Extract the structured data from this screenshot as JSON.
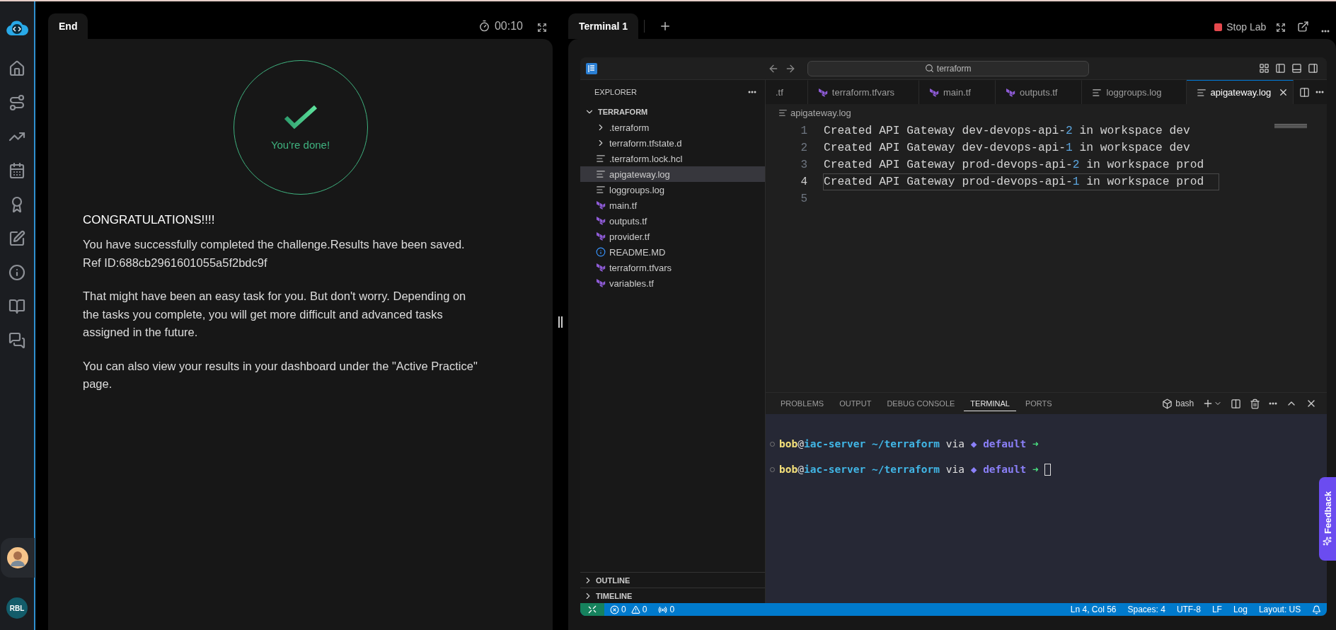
{
  "user": {
    "initials": "RBL"
  },
  "left_panel": {
    "tab": "End",
    "timer": "00:10",
    "status": "You're done!",
    "heading": "CONGRATULATIONS!!!!",
    "paragraphs": [
      "You have successfully completed the challenge.Results have been saved. Ref ID:688cb2961601055a5f2bdc9f",
      "That might have been an easy task for you. But don't worry. Depending on the tasks you complete, you will get more difficult and advanced tasks assigned in the future.",
      "You can also view your results in your dashboard under the \"Active Practice\" page."
    ]
  },
  "right_panel": {
    "tabs": [
      {
        "label": "Terminal 1",
        "selected": true
      }
    ],
    "stop_button": "Stop Lab"
  },
  "vscode": {
    "search": "terraform",
    "explorer": {
      "title": "EXPLORER",
      "tree": {
        "label": "TERRAFORM",
        "expanded": true,
        "children": [
          {
            "label": ".terraform",
            "kind": "folder",
            "expanded": false,
            "selected": false
          },
          {
            "label": "terraform.tfstate.d",
            "kind": "folder",
            "expanded": false,
            "selected": false
          },
          {
            "label": ".terraform.lock.hcl",
            "kind": "log",
            "selected": false
          },
          {
            "label": "apigateway.log",
            "kind": "log",
            "selected": true
          },
          {
            "label": "loggroups.log",
            "kind": "log",
            "selected": false
          },
          {
            "label": "main.tf",
            "kind": "terraform",
            "selected": false
          },
          {
            "label": "outputs.tf",
            "kind": "terraform",
            "selected": false
          },
          {
            "label": "provider.tf",
            "kind": "terraform",
            "selected": false
          },
          {
            "label": "README.MD",
            "kind": "info",
            "selected": false
          },
          {
            "label": "terraform.tfvars",
            "kind": "terraform",
            "selected": false
          },
          {
            "label": "variables.tf",
            "kind": "terraform",
            "selected": false
          }
        ]
      },
      "sections": [
        {
          "label": "OUTLINE",
          "expanded": false
        },
        {
          "label": "TIMELINE",
          "expanded": false
        }
      ]
    },
    "tabs": [
      {
        "label": ".tf",
        "kind": "none",
        "selected": false
      },
      {
        "label": "terraform.tfvars",
        "kind": "terraform",
        "selected": false
      },
      {
        "label": "main.tf",
        "kind": "terraform",
        "selected": false
      },
      {
        "label": "outputs.tf",
        "kind": "terraform",
        "selected": false
      },
      {
        "label": "loggroups.log",
        "kind": "log",
        "selected": false
      },
      {
        "label": "apigateway.log",
        "kind": "log",
        "selected": true
      }
    ],
    "breadcrumb": "apigateway.log",
    "code_lines": [
      {
        "number": "1",
        "current": false,
        "segments": [
          {
            "text": "Created API Gateway dev-devops-api-",
            "kind": "plain"
          },
          {
            "text": "2",
            "kind": "number"
          },
          {
            "text": " in workspace dev",
            "kind": "plain"
          }
        ]
      },
      {
        "number": "2",
        "current": false,
        "segments": [
          {
            "text": "Created API Gateway dev-devops-api-",
            "kind": "plain"
          },
          {
            "text": "1",
            "kind": "number"
          },
          {
            "text": " in workspace dev",
            "kind": "plain"
          }
        ]
      },
      {
        "number": "3",
        "current": false,
        "segments": [
          {
            "text": "Created API Gateway prod-devops-api-",
            "kind": "plain"
          },
          {
            "text": "2",
            "kind": "number"
          },
          {
            "text": " in workspace prod",
            "kind": "plain"
          }
        ]
      },
      {
        "number": "4",
        "current": true,
        "segments": [
          {
            "text": "Created API Gateway prod-devops-api-",
            "kind": "plain"
          },
          {
            "text": "1",
            "kind": "number"
          },
          {
            "text": " in workspace prod",
            "kind": "plain"
          }
        ]
      },
      {
        "number": "5",
        "current": false
      }
    ],
    "panel": {
      "tabs": [
        {
          "label": "PROBLEMS",
          "selected": false
        },
        {
          "label": "OUTPUT",
          "selected": false
        },
        {
          "label": "DEBUG CONSOLE",
          "selected": false
        },
        {
          "label": "TERMINAL",
          "selected": true
        },
        {
          "label": "PORTS",
          "selected": false
        }
      ],
      "shell": "bash",
      "terminal_lines": [
        {
          "cursor": false,
          "segments": [
            {
              "text": "bob",
              "kind": "user"
            },
            {
              "text": "@",
              "kind": "plain"
            },
            {
              "text": "iac-server",
              "kind": "host"
            },
            {
              "text": " ~/terraform",
              "kind": "path"
            },
            {
              "text": " via ",
              "kind": "plain"
            },
            {
              "text": "◆ default",
              "kind": "env"
            },
            {
              "text": " ➜",
              "kind": "arrow"
            }
          ]
        },
        {
          "cursor": true,
          "segments": [
            {
              "text": "bob",
              "kind": "user"
            },
            {
              "text": "@",
              "kind": "plain"
            },
            {
              "text": "iac-server",
              "kind": "host"
            },
            {
              "text": " ~/terraform",
              "kind": "path"
            },
            {
              "text": " via ",
              "kind": "plain"
            },
            {
              "text": "◆ default",
              "kind": "env"
            },
            {
              "text": " ➜",
              "kind": "arrow"
            }
          ]
        }
      ]
    },
    "status_bar": {
      "errors": "0",
      "warnings": "0",
      "ports": "0",
      "items": [
        "Ln 4, Col 56",
        "Spaces: 4",
        "UTF-8",
        "LF",
        "Log",
        "Layout: US"
      ]
    }
  },
  "feedback": "Feedback"
}
